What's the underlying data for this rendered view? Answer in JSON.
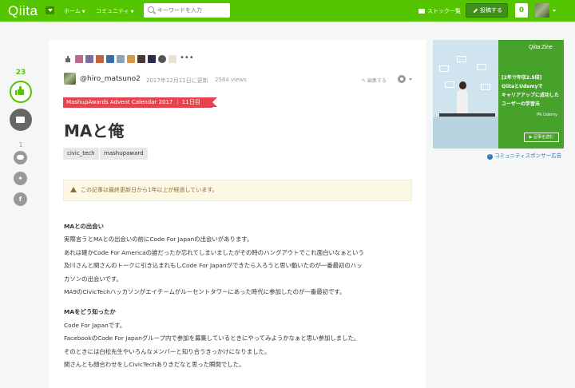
{
  "header": {
    "logo": "Qiita",
    "nav": [
      {
        "label": "ホーム"
      },
      {
        "label": "コミュニティ"
      }
    ],
    "search_placeholder": "キーワードを入力",
    "stock_label": "ストック一覧",
    "post_label": "投稿する",
    "notifications": "0"
  },
  "rail": {
    "likes": "23",
    "comments": "1"
  },
  "article": {
    "more": "•••",
    "author": "@hiro_matsuno2",
    "updated": "2017年12月11日に更新",
    "views": "2584 views",
    "edit": "✎ 編集する",
    "ribbon": "MashupAwards Advent Calendar 2017 ｜ 11日目",
    "title": "MAと俺",
    "tags": [
      "civic_tech",
      "mashupaward"
    ],
    "alert": "この記事は最終更新日から1年以上が経過しています。",
    "sections": [
      {
        "heading": "MAとの出会い",
        "lines": [
          "実際言うとMAとの出会いの前にCode For Japanの出会いがあります。",
          "あれは確かCode For Americaの誰だったか忘れてしまいましたがその時のハングアウトでこれ面白いなぁという",
          "及川さんと関さんのトークに引き込まれもしCode For Japanができたら入ろうと思い動いたのが一番最初のハッ",
          "カソンの出会いです。",
          "MA9のCivicTechハッカソンがエイチームがルーセントタワーにあった時代に参加したのが一番最初です。"
        ]
      },
      {
        "heading": "MAをどう知ったか",
        "lines": [
          "Code For Japanです。",
          "FacebookのCode For Japanグループ内で参加を募集しているときにやってみようかなぁと思い参加しました。",
          "そのときには白松先生やいろんなメンバーと知り合うきっかけになりました。",
          "関さんとも顔合わせをしCivicTechありきだなと思った瞬間でした。"
        ]
      }
    ]
  },
  "ad": {
    "brand": "Qiita:Zine",
    "copy": [
      "[2年で年収2.5倍]",
      "QiitaとUdemyで",
      "キャリアアップに成功した",
      "ユーザーの学習法"
    ],
    "pr": "PR Udemy",
    "button": "▶ 記事を読む",
    "note": "コミュニティスポンサー広告"
  },
  "colors": {
    "brand_green": "#55c500",
    "ribbon_red": "#e6434e",
    "link_blue": "#2f74b5"
  }
}
